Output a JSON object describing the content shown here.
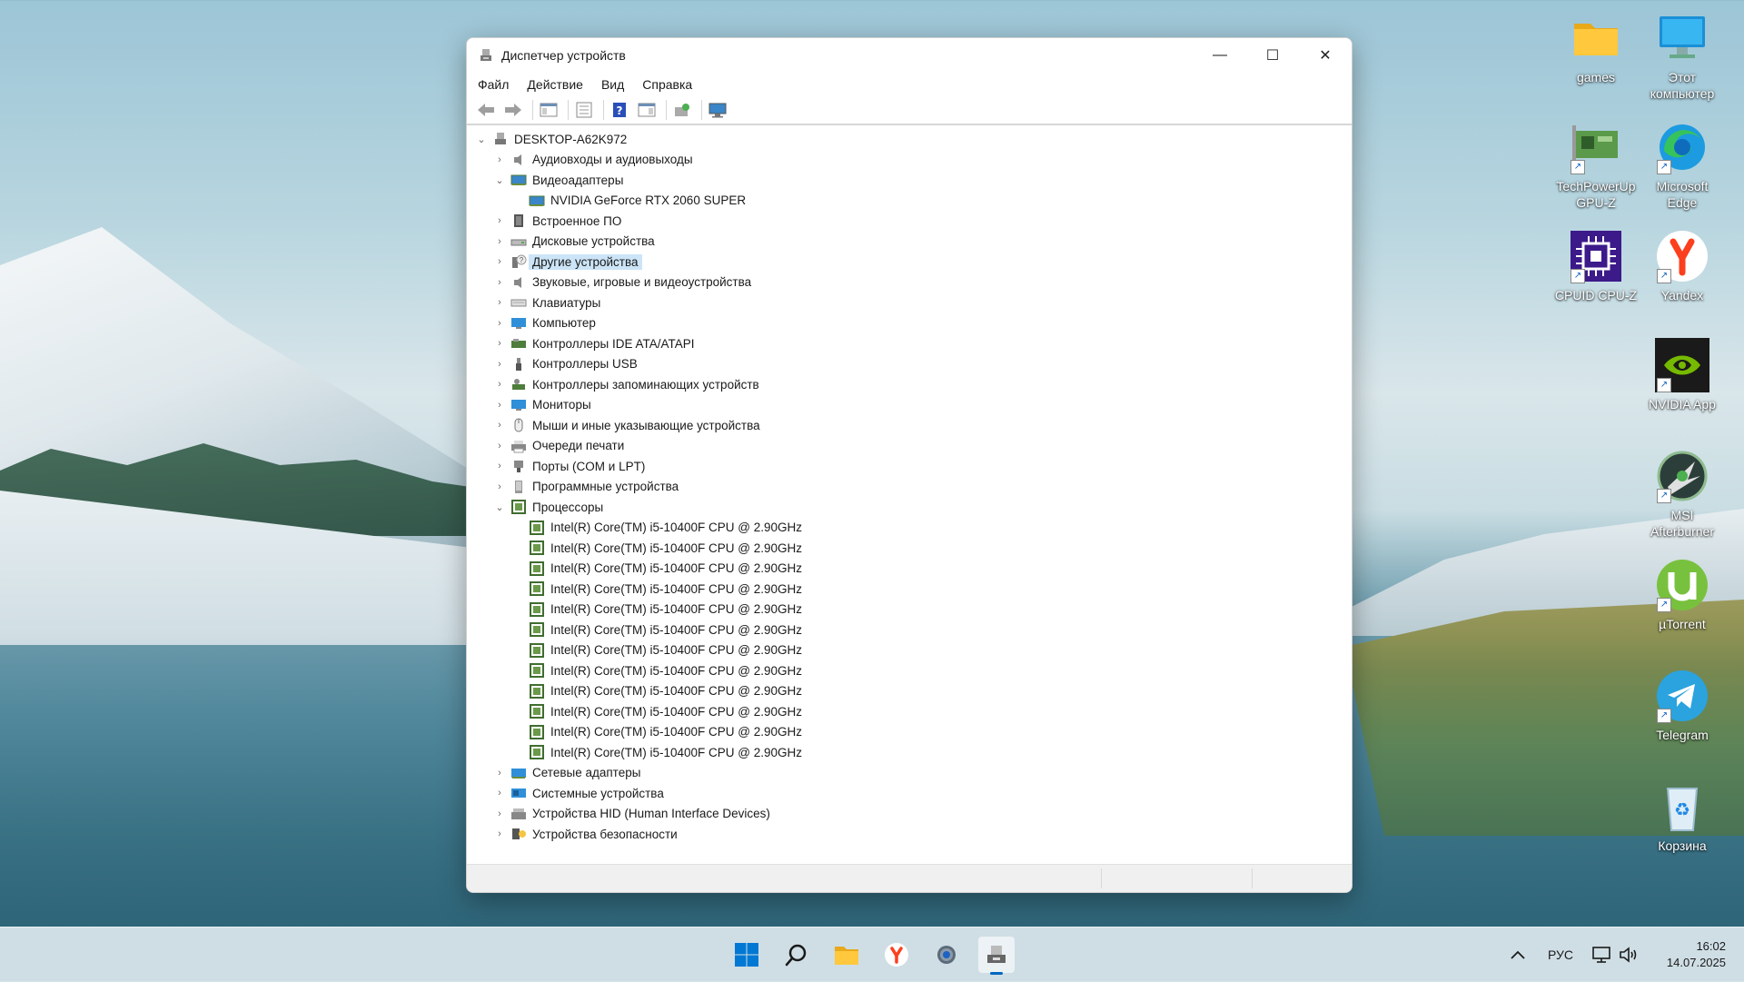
{
  "window": {
    "title": "Диспетчер устройств",
    "controls": {
      "minimize": "—",
      "maximize": "☐",
      "close": "✕"
    }
  },
  "menu": [
    "Файл",
    "Действие",
    "Вид",
    "Справка"
  ],
  "tree": {
    "root": "DESKTOP-A62K972",
    "items": [
      {
        "label": "Аудиовходы и аудиовыходы",
        "icon": "audio-icon",
        "expanded": false
      },
      {
        "label": "Видеоадаптеры",
        "icon": "display-adapter-icon",
        "expanded": true
      },
      {
        "label": "NVIDIA GeForce RTX 2060 SUPER",
        "icon": "display-adapter-icon",
        "child": true
      },
      {
        "label": "Встроенное ПО",
        "icon": "firmware-icon",
        "expanded": false
      },
      {
        "label": "Дисковые устройства",
        "icon": "disk-icon",
        "expanded": false
      },
      {
        "label": "Другие устройства",
        "icon": "unknown-device-icon",
        "expanded": false,
        "selected": true
      },
      {
        "label": "Звуковые, игровые и видеоустройства",
        "icon": "sound-icon",
        "expanded": false
      },
      {
        "label": "Клавиатуры",
        "icon": "keyboard-icon",
        "expanded": false
      },
      {
        "label": "Компьютер",
        "icon": "computer-icon",
        "expanded": false
      },
      {
        "label": "Контроллеры IDE ATA/ATAPI",
        "icon": "ide-icon",
        "expanded": false
      },
      {
        "label": "Контроллеры USB",
        "icon": "usb-icon",
        "expanded": false
      },
      {
        "label": "Контроллеры запоминающих устройств",
        "icon": "storage-controller-icon",
        "expanded": false
      },
      {
        "label": "Мониторы",
        "icon": "monitor-icon",
        "expanded": false
      },
      {
        "label": "Мыши и иные указывающие устройства",
        "icon": "mouse-icon",
        "expanded": false
      },
      {
        "label": "Очереди печати",
        "icon": "printer-icon",
        "expanded": false
      },
      {
        "label": "Порты (COM и LPT)",
        "icon": "port-icon",
        "expanded": false
      },
      {
        "label": "Программные устройства",
        "icon": "software-device-icon",
        "expanded": false
      },
      {
        "label": "Процессоры",
        "icon": "processor-icon",
        "expanded": true
      },
      {
        "label": "Intel(R) Core(TM) i5-10400F CPU @ 2.90GHz",
        "icon": "processor-icon",
        "child": true
      },
      {
        "label": "Intel(R) Core(TM) i5-10400F CPU @ 2.90GHz",
        "icon": "processor-icon",
        "child": true
      },
      {
        "label": "Intel(R) Core(TM) i5-10400F CPU @ 2.90GHz",
        "icon": "processor-icon",
        "child": true
      },
      {
        "label": "Intel(R) Core(TM) i5-10400F CPU @ 2.90GHz",
        "icon": "processor-icon",
        "child": true
      },
      {
        "label": "Intel(R) Core(TM) i5-10400F CPU @ 2.90GHz",
        "icon": "processor-icon",
        "child": true
      },
      {
        "label": "Intel(R) Core(TM) i5-10400F CPU @ 2.90GHz",
        "icon": "processor-icon",
        "child": true
      },
      {
        "label": "Intel(R) Core(TM) i5-10400F CPU @ 2.90GHz",
        "icon": "processor-icon",
        "child": true
      },
      {
        "label": "Intel(R) Core(TM) i5-10400F CPU @ 2.90GHz",
        "icon": "processor-icon",
        "child": true
      },
      {
        "label": "Intel(R) Core(TM) i5-10400F CPU @ 2.90GHz",
        "icon": "processor-icon",
        "child": true
      },
      {
        "label": "Intel(R) Core(TM) i5-10400F CPU @ 2.90GHz",
        "icon": "processor-icon",
        "child": true
      },
      {
        "label": "Intel(R) Core(TM) i5-10400F CPU @ 2.90GHz",
        "icon": "processor-icon",
        "child": true
      },
      {
        "label": "Intel(R) Core(TM) i5-10400F CPU @ 2.90GHz",
        "icon": "processor-icon",
        "child": true
      },
      {
        "label": "Сетевые адаптеры",
        "icon": "network-adapter-icon",
        "expanded": false
      },
      {
        "label": "Системные устройства",
        "icon": "system-device-icon",
        "expanded": false
      },
      {
        "label": "Устройства HID (Human Interface Devices)",
        "icon": "hid-icon",
        "expanded": false
      },
      {
        "label": "Устройства безопасности",
        "icon": "security-device-icon",
        "expanded": false
      }
    ]
  },
  "desktop": [
    {
      "id": "games",
      "label1": "games",
      "label2": ""
    },
    {
      "id": "this-pc",
      "label1": "Этот",
      "label2": "компьютер"
    },
    {
      "id": "gpuz",
      "label1": "TechPowerUp",
      "label2": "GPU-Z"
    },
    {
      "id": "edge",
      "label1": "Microsoft",
      "label2": "Edge"
    },
    {
      "id": "cpuz",
      "label1": "CPUID CPU-Z",
      "label2": ""
    },
    {
      "id": "yandex",
      "label1": "Yandex",
      "label2": ""
    },
    {
      "id": "nvidia",
      "label1": "NVIDIA App",
      "label2": ""
    },
    {
      "id": "afterburner",
      "label1": "MSI",
      "label2": "Afterburner"
    },
    {
      "id": "utorrent",
      "label1": "µTorrent",
      "label2": ""
    },
    {
      "id": "telegram",
      "label1": "Telegram",
      "label2": ""
    },
    {
      "id": "recycle",
      "label1": "Корзина",
      "label2": ""
    }
  ],
  "taskbar": {
    "lang": "РУС",
    "time": "16:02",
    "date": "14.07.2025"
  },
  "colors": {
    "accent": "#0067c0",
    "selection": "#cce4f7"
  }
}
